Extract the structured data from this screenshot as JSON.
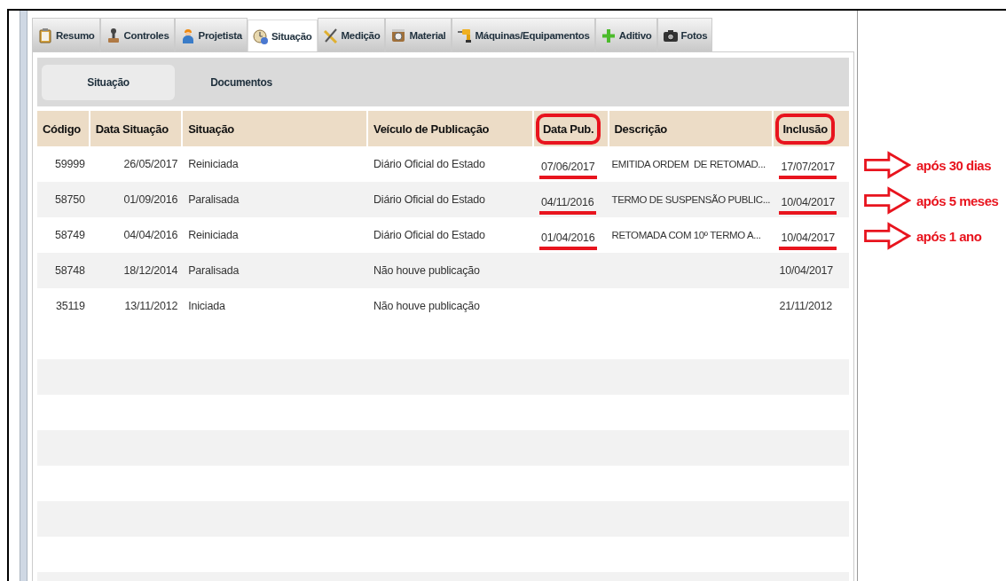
{
  "tabs": [
    {
      "label": "Resumo",
      "selected": false
    },
    {
      "label": "Controles",
      "selected": false
    },
    {
      "label": "Projetista",
      "selected": false
    },
    {
      "label": "Situação",
      "selected": true
    },
    {
      "label": "Medição",
      "selected": false
    },
    {
      "label": "Material",
      "selected": false
    },
    {
      "label": "Máquinas/Equipamentos",
      "selected": false
    },
    {
      "label": "Aditivo",
      "selected": false
    },
    {
      "label": "Fotos",
      "selected": false
    }
  ],
  "subtabs": [
    {
      "label": "Situação",
      "selected": true
    },
    {
      "label": "Documentos",
      "selected": false
    }
  ],
  "table": {
    "columns": [
      {
        "label": "Código",
        "circled": false
      },
      {
        "label": "Data Situação",
        "circled": false
      },
      {
        "label": "Situação",
        "circled": false
      },
      {
        "label": "Veículo de Publicação",
        "circled": false
      },
      {
        "label": "Data Pub.",
        "circled": true
      },
      {
        "label": "Descrição",
        "circled": false
      },
      {
        "label": "Inclusão",
        "circled": true
      }
    ],
    "rows": [
      {
        "cells": [
          {
            "text": "59999"
          },
          {
            "text": "26/05/2017"
          },
          {
            "text": "Reiniciada"
          },
          {
            "text": "Diário Oficial do Estado"
          },
          {
            "text": "07/06/2017",
            "underlined": true
          },
          {
            "text": "EMITIDA ORDEM  DE RETOMAD..."
          },
          {
            "text": "17/07/2017",
            "underlined": true
          }
        ]
      },
      {
        "cells": [
          {
            "text": "58750"
          },
          {
            "text": "01/09/2016"
          },
          {
            "text": "Paralisada"
          },
          {
            "text": "Diário Oficial do Estado"
          },
          {
            "text": "04/11/2016",
            "underlined": true
          },
          {
            "text": "TERMO DE SUSPENSÃO PUBLIC..."
          },
          {
            "text": "10/04/2017",
            "underlined": true
          }
        ]
      },
      {
        "cells": [
          {
            "text": "58749"
          },
          {
            "text": "04/04/2016"
          },
          {
            "text": "Reiniciada"
          },
          {
            "text": "Diário Oficial do Estado"
          },
          {
            "text": "01/04/2016",
            "underlined": true
          },
          {
            "text": "RETOMADA COM 10º TERMO A..."
          },
          {
            "text": "10/04/2017",
            "underlined": true
          }
        ]
      },
      {
        "cells": [
          {
            "text": "58748"
          },
          {
            "text": "18/12/2014"
          },
          {
            "text": "Paralisada"
          },
          {
            "text": "Não houve publicação"
          },
          null,
          null,
          {
            "text": "10/04/2017"
          }
        ]
      },
      {
        "cells": [
          {
            "text": "35119"
          },
          {
            "text": "13/11/2012"
          },
          {
            "text": "Iniciada"
          },
          {
            "text": "Não houve publicação"
          },
          null,
          null,
          {
            "text": "21/11/2012"
          }
        ]
      }
    ]
  },
  "annotations": [
    {
      "text": "após 30 dias"
    },
    {
      "text": "após 5 meses"
    },
    {
      "text": "após 1 ano"
    }
  ]
}
